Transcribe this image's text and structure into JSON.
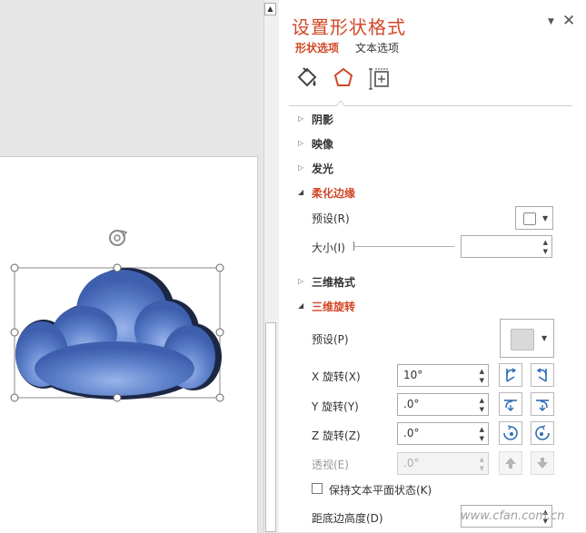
{
  "panel": {
    "title": "设置形状格式",
    "tabs": [
      {
        "label": "形状选项",
        "active": true
      },
      {
        "label": "文本选项",
        "active": false
      }
    ],
    "icon_tabs": [
      "fill-line-icon",
      "effects-pentagon-icon",
      "size-properties-icon"
    ],
    "accent_color": "#d24726",
    "sections": {
      "shadow": "阴影",
      "reflection": "映像",
      "glow": "发光",
      "soft_edges": "柔化边缘",
      "format_3d": "三维格式",
      "rotation_3d": "三维旋转"
    },
    "soft_edges": {
      "preset_label": "预设(R)",
      "size_label": "大小(I)",
      "size_value": ""
    },
    "rotation": {
      "preset_label": "预设(P)",
      "x_label": "X 旋转(X)",
      "x_value": "10°",
      "y_label": "Y 旋转(Y)",
      "y_value": ".0°",
      "z_label": "Z 旋转(Z)",
      "z_value": ".0°",
      "perspective_label": "透视(E)",
      "perspective_value": ".0°",
      "keep_text_flat_label": "保持文本平面状态(K)",
      "keep_text_flat_checked": false,
      "distance_label": "距底边高度(D)"
    }
  },
  "watermark": "www.cfan.com.cn"
}
